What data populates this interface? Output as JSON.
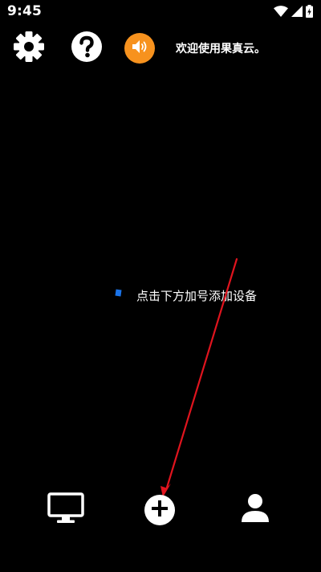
{
  "status_bar": {
    "time": "9:45",
    "icons": [
      "wifi-icon",
      "cellular-signal-icon",
      "battery-icon"
    ]
  },
  "top_bar": {
    "icons": [
      "gear-icon",
      "question-icon",
      "speaker-icon"
    ],
    "welcome_text": "欢迎使用果真云。"
  },
  "main": {
    "hint_text": "点击下方加号添加设备"
  },
  "bottom_nav": {
    "icons": [
      "monitor-icon",
      "plus-icon",
      "user-icon"
    ]
  },
  "colors": {
    "background": "#000000",
    "accent_orange": "#f7921e",
    "annotation_arrow": "#e0141e",
    "hint_dot": "#1a73e8"
  }
}
